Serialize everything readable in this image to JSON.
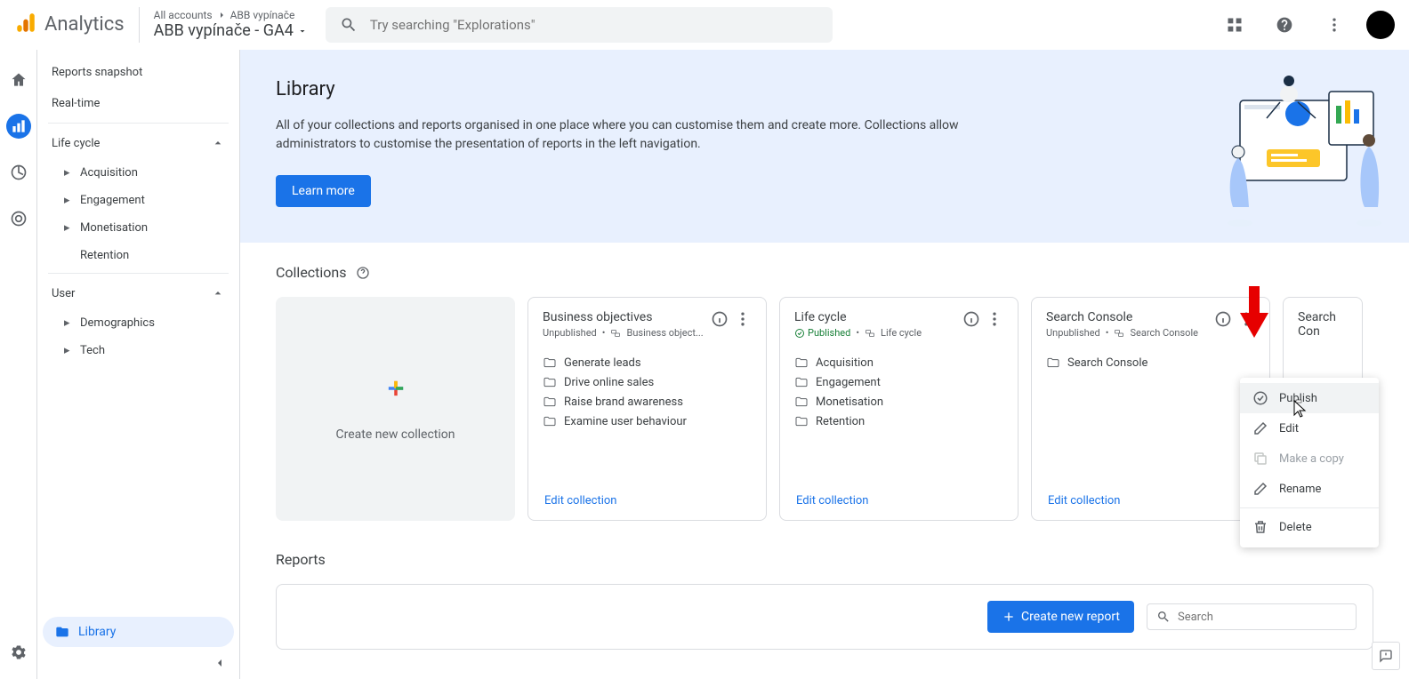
{
  "header": {
    "product": "Analytics",
    "breadcrumb_all": "All accounts",
    "breadcrumb_acct": "ABB vypínače",
    "property": "ABB vypínače - GA4",
    "search_placeholder": "Try searching \"Explorations\""
  },
  "sidebar": {
    "snapshot": "Reports snapshot",
    "realtime": "Real-time",
    "group1": {
      "label": "Life cycle",
      "items": [
        "Acquisition",
        "Engagement",
        "Monetisation",
        "Retention"
      ]
    },
    "group2": {
      "label": "User",
      "items": [
        "Demographics",
        "Tech"
      ]
    },
    "library": "Library"
  },
  "hero": {
    "title": "Library",
    "desc": "All of your collections and reports organised in one place where you can customise them and create more. Collections allow administrators to customise the presentation of reports in the left navigation.",
    "button": "Learn more"
  },
  "collections": {
    "heading": "Collections",
    "create_label": "Create new collection",
    "edit_label": "Edit collection",
    "unpublished": "Unpublished",
    "published": "Published",
    "cards": [
      {
        "title": "Business objectives",
        "template": "Business object...",
        "items": [
          "Generate leads",
          "Drive online sales",
          "Raise brand awareness",
          "Examine user behaviour"
        ]
      },
      {
        "title": "Life cycle",
        "template": "Life cycle",
        "items": [
          "Acquisition",
          "Engagement",
          "Monetisation",
          "Retention"
        ]
      },
      {
        "title": "Search Console",
        "template": "Search Console",
        "items": [
          "Search Console"
        ]
      },
      {
        "title": "Search Con",
        "template": "",
        "items": []
      }
    ]
  },
  "reports": {
    "heading": "Reports",
    "create_btn": "Create new report",
    "search_placeholder": "Search"
  },
  "ctx": {
    "publish": "Publish",
    "edit": "Edit",
    "copy": "Make a copy",
    "rename": "Rename",
    "delete": "Delete"
  }
}
